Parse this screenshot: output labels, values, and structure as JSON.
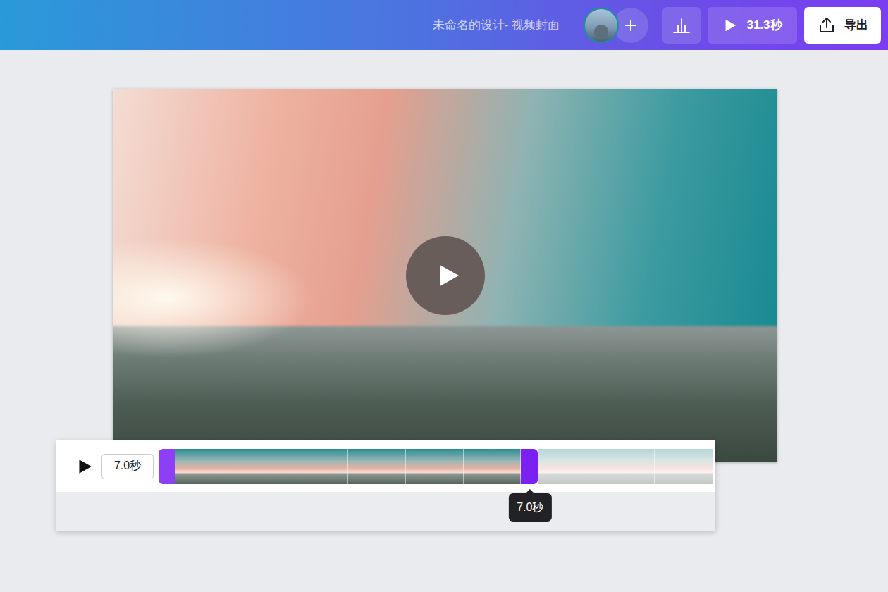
{
  "topbar": {
    "title": "未命名的设计- 视频封面",
    "play_button": {
      "label": "31.3秒"
    },
    "export_button": {
      "label": "导出"
    }
  },
  "video": {
    "playing": false
  },
  "timeline": {
    "playing": false,
    "duration": "7.0秒",
    "trim": {
      "level": 0.684,
      "tooltip": "7.0秒"
    },
    "frames": [
      {
        "selected": true
      },
      {
        "selected": true
      },
      {
        "selected": true
      },
      {
        "selected": true
      },
      {
        "selected": true
      },
      {
        "selected": true
      },
      {
        "selected": false
      },
      {
        "selected": false
      },
      {
        "selected": false
      }
    ]
  }
}
